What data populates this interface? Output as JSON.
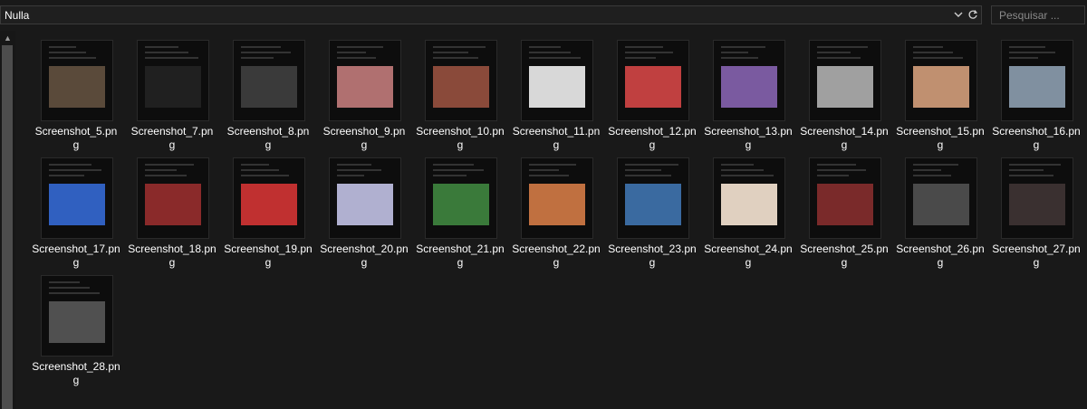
{
  "address_bar": {
    "path": "Nulla"
  },
  "search": {
    "placeholder": "Pesquisar ..."
  },
  "icons": {
    "dropdown": "chevron-down-icon",
    "refresh": "refresh-icon",
    "search": "search-icon",
    "scroll_up": "scroll-up-arrow-icon"
  },
  "files": [
    {
      "name": "Screenshot_5.png",
      "label_line1": "Screenshot_5.pn",
      "label_line2": "g",
      "accent": "#5a4a3a"
    },
    {
      "name": "Screenshot_7.png",
      "label_line1": "Screenshot_7.pn",
      "label_line2": "g",
      "accent": "#202020"
    },
    {
      "name": "Screenshot_8.png",
      "label_line1": "Screenshot_8.pn",
      "label_line2": "g",
      "accent": "#3a3a3a"
    },
    {
      "name": "Screenshot_9.png",
      "label_line1": "Screenshot_9.pn",
      "label_line2": "g",
      "accent": "#b07070"
    },
    {
      "name": "Screenshot_10.png",
      "label_line1": "Screenshot_10.pn",
      "label_line2": "g",
      "accent": "#8a4a3a"
    },
    {
      "name": "Screenshot_11.png",
      "label_line1": "Screenshot_11.pn",
      "label_line2": "g",
      "accent": "#d8d8d8"
    },
    {
      "name": "Screenshot_12.png",
      "label_line1": "Screenshot_12.pn",
      "label_line2": "g",
      "accent": "#c04040"
    },
    {
      "name": "Screenshot_13.png",
      "label_line1": "Screenshot_13.pn",
      "label_line2": "g",
      "accent": "#7a5aa0"
    },
    {
      "name": "Screenshot_14.png",
      "label_line1": "Screenshot_14.pn",
      "label_line2": "g",
      "accent": "#a0a0a0"
    },
    {
      "name": "Screenshot_15.png",
      "label_line1": "Screenshot_15.pn",
      "label_line2": "g",
      "accent": "#c09070"
    },
    {
      "name": "Screenshot_16.png",
      "label_line1": "Screenshot_16.pn",
      "label_line2": "g",
      "accent": "#8090a0"
    },
    {
      "name": "Screenshot_17.png",
      "label_line1": "Screenshot_17.pn",
      "label_line2": "g",
      "accent": "#3060c0"
    },
    {
      "name": "Screenshot_18.png",
      "label_line1": "Screenshot_18.pn",
      "label_line2": "g",
      "accent": "#8a2a2a"
    },
    {
      "name": "Screenshot_19.png",
      "label_line1": "Screenshot_19.pn",
      "label_line2": "g",
      "accent": "#c03030"
    },
    {
      "name": "Screenshot_20.png",
      "label_line1": "Screenshot_20.pn",
      "label_line2": "g",
      "accent": "#b0b0d0"
    },
    {
      "name": "Screenshot_21.png",
      "label_line1": "Screenshot_21.pn",
      "label_line2": "g",
      "accent": "#3a7a3a"
    },
    {
      "name": "Screenshot_22.png",
      "label_line1": "Screenshot_22.pn",
      "label_line2": "g",
      "accent": "#c07040"
    },
    {
      "name": "Screenshot_23.png",
      "label_line1": "Screenshot_23.pn",
      "label_line2": "g",
      "accent": "#3a6aa0"
    },
    {
      "name": "Screenshot_24.png",
      "label_line1": "Screenshot_24.pn",
      "label_line2": "g",
      "accent": "#e0d0c0"
    },
    {
      "name": "Screenshot_25.png",
      "label_line1": "Screenshot_25.pn",
      "label_line2": "g",
      "accent": "#7a2a2a"
    },
    {
      "name": "Screenshot_26.png",
      "label_line1": "Screenshot_26.pn",
      "label_line2": "g",
      "accent": "#4a4a4a"
    },
    {
      "name": "Screenshot_27.png",
      "label_line1": "Screenshot_27.pn",
      "label_line2": "g",
      "accent": "#3a3030"
    },
    {
      "name": "Screenshot_28.png",
      "label_line1": "Screenshot_28.pn",
      "label_line2": "g",
      "accent": "#505050"
    }
  ]
}
